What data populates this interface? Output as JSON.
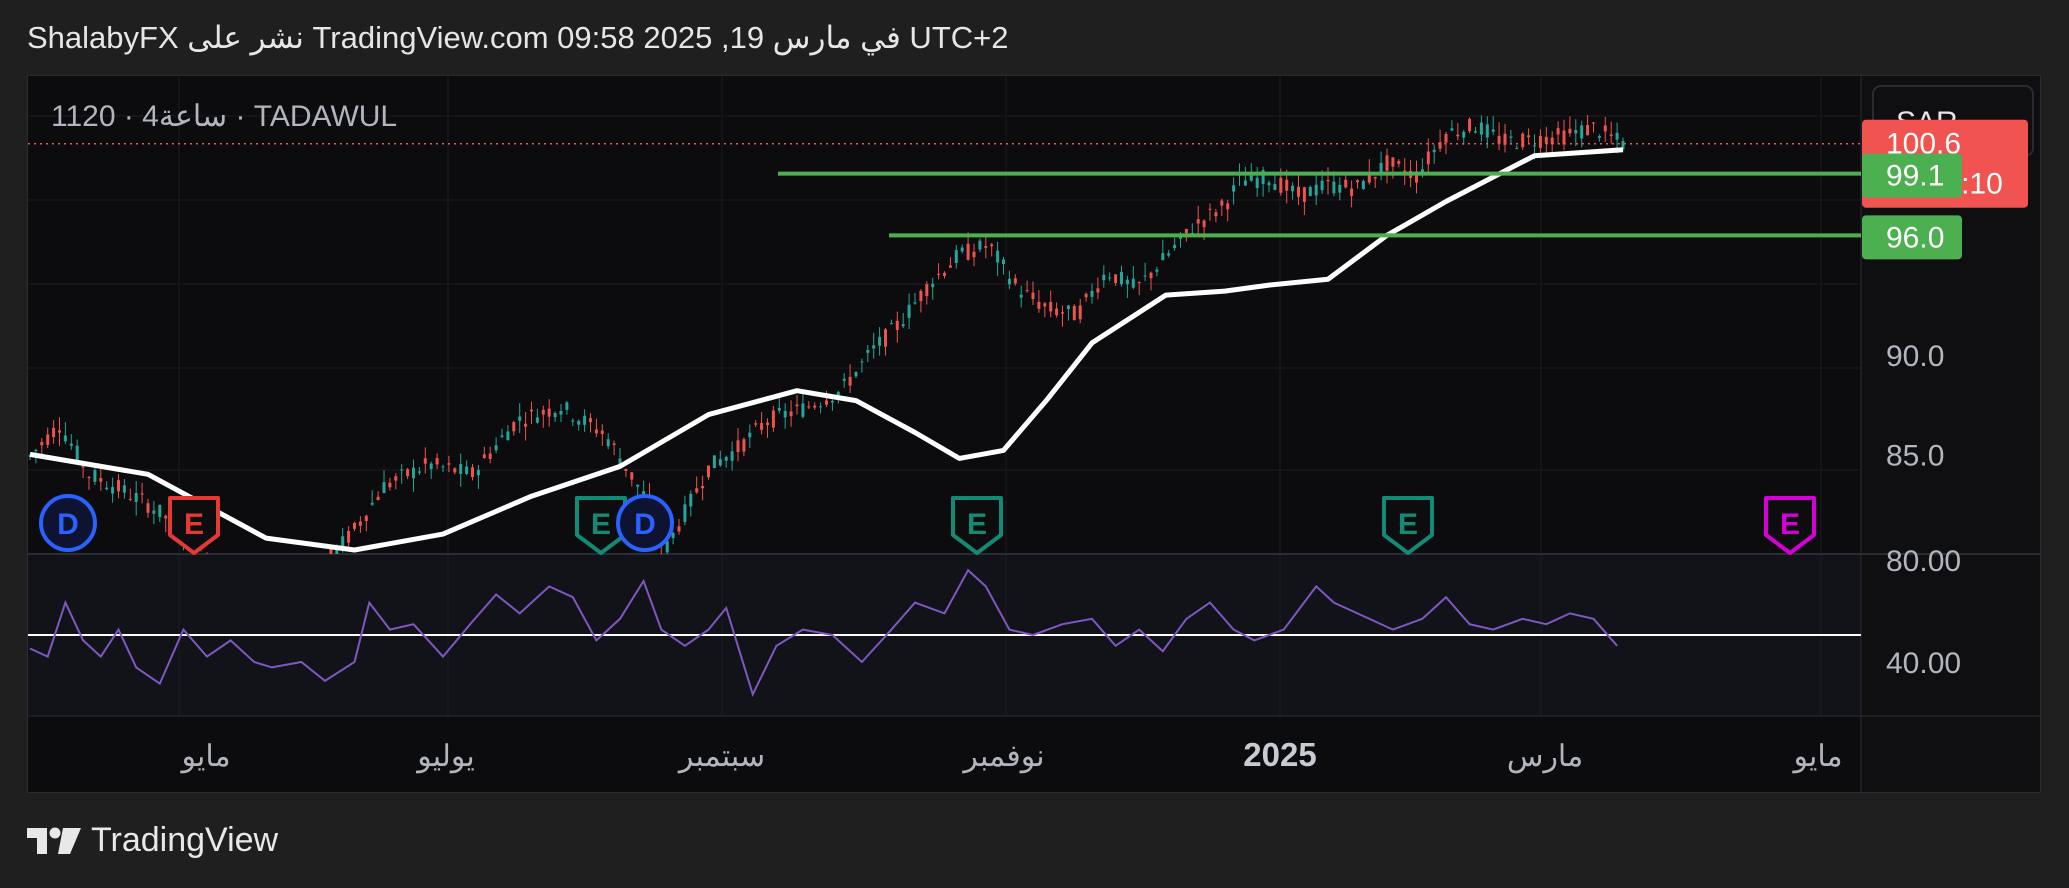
{
  "header": {
    "publish_text": "ShalabyFX نشر على TradingView.com في مارس 19, 2025 09:58 UTC+2"
  },
  "chart_data": {
    "type": "candlestick",
    "symbol_line": "1120 · 4ساعة · TADAWUL",
    "currency": "SAR",
    "price_axis": {
      "range": [
        80.0,
        104.0
      ],
      "ticks": [
        "90.0",
        "85.0"
      ],
      "top_partial_label": "80.00"
    },
    "last_price": {
      "value": 100.6,
      "label": "100.6",
      "countdown": "03:16:10",
      "color": "#f05350"
    },
    "levels": [
      {
        "value": 99.1,
        "label": "99.1",
        "color": "#4caf50"
      },
      {
        "value": 96.0,
        "label": "96.0",
        "color": "#4caf50"
      }
    ],
    "moving_average": {
      "color": "#ffffff"
    },
    "time_axis": {
      "labels": [
        "مايو",
        "يوليو",
        "سبتمبر",
        "نوفمبر",
        "2025",
        "مارس",
        "مايو"
      ]
    },
    "events": [
      {
        "kind": "D",
        "time": "Apr 2024",
        "color": "#2962ff"
      },
      {
        "kind": "E",
        "time": "Apr 2024",
        "color": "#e53935"
      },
      {
        "kind": "E",
        "time": "Aug 2024",
        "color": "#138a74"
      },
      {
        "kind": "D",
        "time": "Aug 2024",
        "color": "#2962ff"
      },
      {
        "kind": "E",
        "time": "Oct 2024",
        "color": "#138a74"
      },
      {
        "kind": "E",
        "time": "Jan 2025",
        "color": "#138a74"
      },
      {
        "kind": "E",
        "time": "Apr 2025",
        "color": "#d500d5"
      }
    ],
    "rsi": {
      "range": [
        20,
        80
      ],
      "ticks": [
        "40.00"
      ],
      "top_partial_label": "80.00",
      "reference_level": 50,
      "color": "#7e57c2"
    },
    "price_path": [
      [
        0,
        84.9
      ],
      [
        10,
        86.5
      ],
      [
        20,
        84.0
      ],
      [
        30,
        83.3
      ],
      [
        40,
        82.5
      ],
      [
        50,
        81.4
      ],
      [
        60,
        79.9
      ],
      [
        70,
        78.8
      ],
      [
        80,
        78.2
      ],
      [
        90,
        78.5
      ],
      [
        100,
        79.5
      ],
      [
        110,
        81.2
      ],
      [
        120,
        83.4
      ],
      [
        135,
        84.5
      ],
      [
        150,
        84.0
      ],
      [
        165,
        86.7
      ],
      [
        180,
        87.4
      ],
      [
        195,
        86.0
      ],
      [
        210,
        82.5
      ],
      [
        215,
        80.1
      ],
      [
        220,
        81.5
      ],
      [
        230,
        84.3
      ],
      [
        240,
        85.3
      ],
      [
        250,
        86.7
      ],
      [
        262,
        87.3
      ],
      [
        275,
        88.2
      ],
      [
        285,
        90.1
      ],
      [
        295,
        91.6
      ],
      [
        305,
        93.6
      ],
      [
        315,
        95.0
      ],
      [
        325,
        95.5
      ],
      [
        335,
        93.3
      ],
      [
        345,
        92.3
      ],
      [
        355,
        92.0
      ],
      [
        365,
        94.2
      ],
      [
        375,
        93.3
      ],
      [
        385,
        94.9
      ],
      [
        395,
        96.5
      ],
      [
        405,
        97.5
      ],
      [
        410,
        98.7
      ],
      [
        420,
        98.9
      ],
      [
        430,
        98.0
      ],
      [
        440,
        98.5
      ],
      [
        450,
        98.4
      ],
      [
        460,
        99.6
      ],
      [
        470,
        99.0
      ],
      [
        480,
        101.1
      ],
      [
        490,
        101.5
      ],
      [
        500,
        100.7
      ],
      [
        510,
        100.8
      ],
      [
        520,
        101.0
      ],
      [
        530,
        101.4
      ],
      [
        540,
        100.6
      ]
    ],
    "ma_path": [
      [
        0,
        85.0
      ],
      [
        40,
        84.0
      ],
      [
        80,
        80.8
      ],
      [
        110,
        80.2
      ],
      [
        140,
        81.0
      ],
      [
        170,
        82.9
      ],
      [
        200,
        84.4
      ],
      [
        230,
        87.0
      ],
      [
        260,
        88.2
      ],
      [
        280,
        87.7
      ],
      [
        300,
        86.1
      ],
      [
        315,
        84.8
      ],
      [
        330,
        85.2
      ],
      [
        345,
        87.8
      ],
      [
        360,
        90.6
      ],
      [
        385,
        93.0
      ],
      [
        405,
        93.2
      ],
      [
        420,
        93.5
      ],
      [
        440,
        93.8
      ],
      [
        460,
        96.0
      ],
      [
        480,
        97.7
      ],
      [
        510,
        100.0
      ],
      [
        540,
        100.3
      ]
    ],
    "rsi_path": [
      [
        0,
        45
      ],
      [
        6,
        42
      ],
      [
        12,
        62
      ],
      [
        18,
        48
      ],
      [
        24,
        42
      ],
      [
        30,
        52
      ],
      [
        36,
        38
      ],
      [
        44,
        32
      ],
      [
        52,
        52
      ],
      [
        60,
        42
      ],
      [
        68,
        48
      ],
      [
        76,
        40
      ],
      [
        82,
        38
      ],
      [
        92,
        40
      ],
      [
        100,
        33
      ],
      [
        110,
        40
      ],
      [
        115,
        62
      ],
      [
        122,
        52
      ],
      [
        130,
        54
      ],
      [
        140,
        42
      ],
      [
        150,
        55
      ],
      [
        158,
        65
      ],
      [
        166,
        58
      ],
      [
        176,
        68
      ],
      [
        184,
        64
      ],
      [
        192,
        48
      ],
      [
        200,
        56
      ],
      [
        208,
        70
      ],
      [
        214,
        52
      ],
      [
        222,
        46
      ],
      [
        230,
        52
      ],
      [
        236,
        60
      ],
      [
        245,
        28
      ],
      [
        253,
        46
      ],
      [
        262,
        52
      ],
      [
        272,
        50
      ],
      [
        282,
        40
      ],
      [
        292,
        52
      ],
      [
        300,
        62
      ],
      [
        310,
        58
      ],
      [
        318,
        74
      ],
      [
        324,
        68
      ],
      [
        332,
        52
      ],
      [
        340,
        50
      ],
      [
        350,
        54
      ],
      [
        360,
        56
      ],
      [
        368,
        46
      ],
      [
        376,
        52
      ],
      [
        384,
        44
      ],
      [
        392,
        56
      ],
      [
        400,
        62
      ],
      [
        408,
        52
      ],
      [
        415,
        48
      ],
      [
        425,
        52
      ],
      [
        436,
        68
      ],
      [
        442,
        62
      ],
      [
        450,
        58
      ],
      [
        462,
        52
      ],
      [
        472,
        56
      ],
      [
        480,
        64
      ],
      [
        488,
        54
      ],
      [
        496,
        52
      ],
      [
        506,
        56
      ],
      [
        514,
        54
      ],
      [
        522,
        58
      ],
      [
        530,
        56
      ],
      [
        538,
        46
      ]
    ]
  }
}
